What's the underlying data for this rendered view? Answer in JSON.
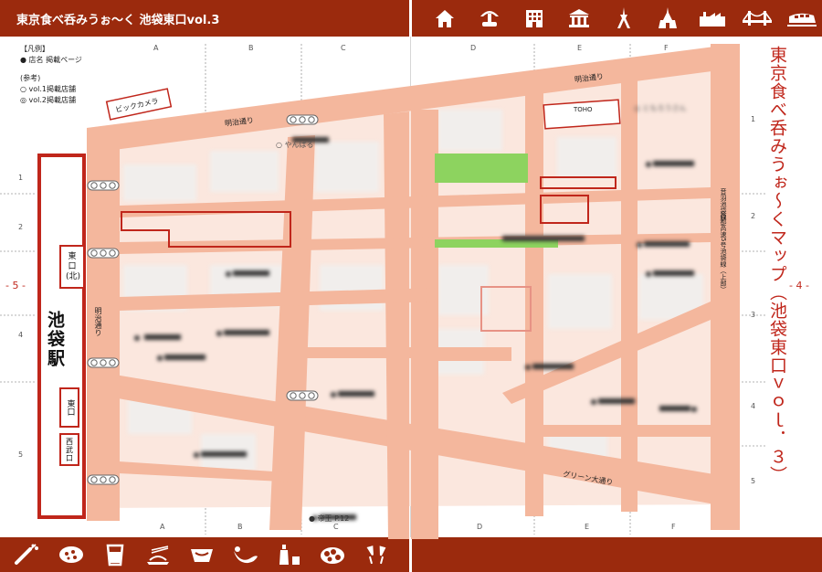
{
  "header": {
    "title": "東京食べ呑みうぉ〜く 池袋東口vol.3",
    "title_color": "#ffffff",
    "bar_color": "#9b2a0d"
  },
  "top_icons": [
    "house-icon",
    "fountain-icon",
    "building-icon",
    "museum-icon",
    "tower-icon",
    "castle-icon",
    "factory-icon",
    "bridge-icon",
    "train-icon"
  ],
  "bottom_icons": [
    "toast-icon",
    "pizza-icon",
    "beer-glass-icon",
    "noodle-icon",
    "bento-icon",
    "eel-icon",
    "sake-bottle-icon",
    "dish-icon",
    "cheers-icon"
  ],
  "legend": {
    "heading": "【凡例】",
    "shop": "● 店名 掲載ページ",
    "ref_heading": "(参考)",
    "vol1": "○ vol.1掲載店舗",
    "vol2": "◎ vol.2掲載店舗"
  },
  "page_title_vertical": "東京食べ呑みうぉ〜くマップ（池袋東口ｖｏｌ．３）",
  "page_numbers": {
    "left": "- 5 -",
    "right": "- 4 -"
  },
  "station": {
    "name": "池袋駅",
    "exit_north": "東口(北)",
    "exit_east": "東口",
    "exit_west": "西武口"
  },
  "streets": {
    "meiji_top": "明治通り",
    "meiji_mid": "明治通り",
    "meiji_vertical": "明治通り",
    "green": "グリーン大通り",
    "highway": "首都高速5号池袋線（上部）",
    "highway_short": "音羽池袋線"
  },
  "landmarks": {
    "bic": "ビックカメラ",
    "toho": "TOHO",
    "yanbaru": "○ やんばる",
    "right_top_shop": "◎ ともろうさん",
    "bottom_shop": "● 帝王 P.12"
  },
  "grid": {
    "cols_left": [
      "A",
      "B",
      "C"
    ],
    "cols_right": [
      "D",
      "E",
      "F"
    ],
    "rows_left": [
      "1",
      "2",
      "3",
      "4",
      "5"
    ],
    "rows_right": [
      "1",
      "2",
      "3",
      "4",
      "5"
    ]
  },
  "colors": {
    "road": "#f4b79d",
    "station": "#c0261b",
    "park": "#8dd35f",
    "accent": "#9b2a0d"
  }
}
